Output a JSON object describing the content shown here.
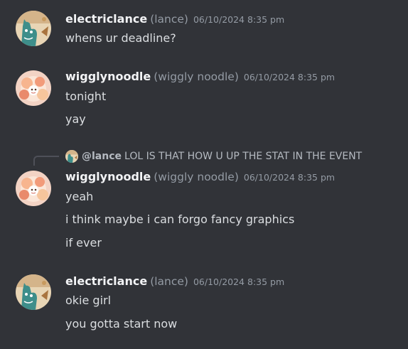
{
  "messages": [
    {
      "username": "electriclance",
      "nickname": "(lance)",
      "timestamp": "06/10/2024 8:35 pm",
      "avatar": "cat-avatar-icon",
      "lines": [
        "whens ur deadline?"
      ]
    },
    {
      "username": "wigglynoodle",
      "nickname": "(wiggly noodle)",
      "timestamp": "06/10/2024 8:35 pm",
      "avatar": "flower-avatar-icon",
      "lines": [
        "tonight",
        "yay"
      ]
    },
    {
      "reply": {
        "mention": "@lance",
        "text": "LOL IS THAT HOW U UP THE STAT IN THE EVENT"
      },
      "username": "wigglynoodle",
      "nickname": "(wiggly noodle)",
      "timestamp": "06/10/2024 8:35 pm",
      "avatar": "flower-avatar-icon",
      "lines": [
        "yeah",
        "i think maybe i can forgo fancy graphics",
        "if ever"
      ]
    },
    {
      "username": "electriclance",
      "nickname": "(lance)",
      "timestamp": "06/10/2024 8:35 pm",
      "avatar": "cat-avatar-icon",
      "lines": [
        "okie girl",
        "you gotta start now"
      ]
    }
  ],
  "colors": {
    "background": "#313338",
    "username": "#f2f3f5",
    "muted": "#949ba4",
    "text": "#dbdee1"
  }
}
